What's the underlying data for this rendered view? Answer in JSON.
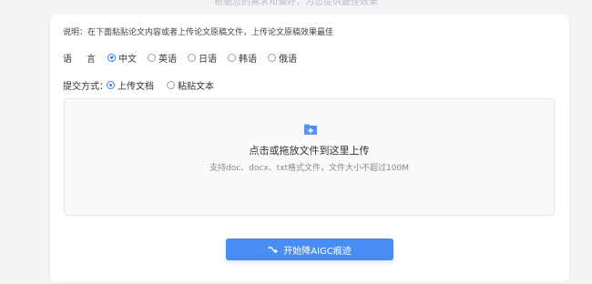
{
  "page": {
    "top_cut_text": "根据您的需求和偏好，为您提供最佳效果"
  },
  "description": "说明：在下面粘贴论文内容或者上传论文原稿文件，上传论文原稿效果最佳",
  "language": {
    "label": "语言：",
    "options": [
      {
        "label": "中文",
        "checked": true
      },
      {
        "label": "英语",
        "checked": false
      },
      {
        "label": "日语",
        "checked": false
      },
      {
        "label": "韩语",
        "checked": false
      },
      {
        "label": "俄语",
        "checked": false
      }
    ]
  },
  "submit_mode": {
    "label": "提交方式：",
    "options": [
      {
        "label": "上传文档",
        "checked": true
      },
      {
        "label": "粘贴文本",
        "checked": false
      }
    ]
  },
  "upload": {
    "icon": "folder-plus-icon",
    "title": "点击或拖放文件到这里上传",
    "hint": "支持doc、docx、txt格式文件，文件大小不超过100M"
  },
  "start_button": {
    "icon": "sparkle-wand-icon",
    "label": "开始降AIGC痕迹"
  },
  "colors": {
    "accent": "#4a8df2",
    "radio_active": "#3d7ef0",
    "background": "#f4f5f7"
  }
}
